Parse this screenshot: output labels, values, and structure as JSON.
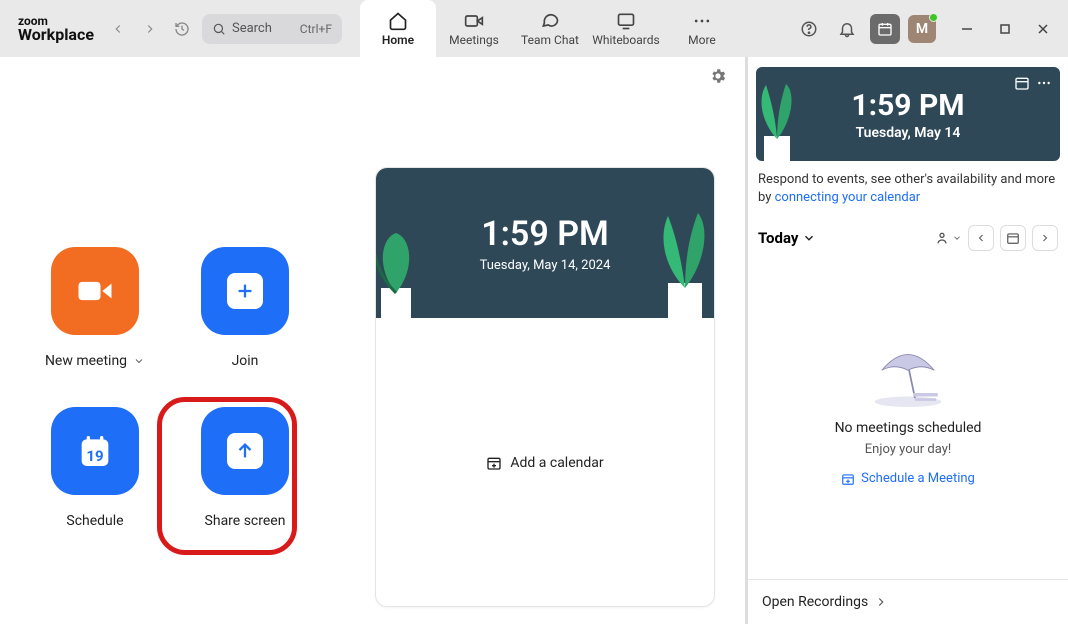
{
  "brand": {
    "line1": "zoom",
    "line2": "Workplace"
  },
  "search": {
    "placeholder": "Search",
    "shortcut": "Ctrl+F"
  },
  "tabs": {
    "home": "Home",
    "meetings": "Meetings",
    "teamchat": "Team Chat",
    "whiteboards": "Whiteboards",
    "more": "More"
  },
  "avatar": {
    "initial": "M"
  },
  "actions": {
    "new_meeting": "New meeting",
    "join": "Join",
    "schedule": "Schedule",
    "schedule_day": "19",
    "share_screen": "Share screen"
  },
  "card": {
    "time": "1:59 PM",
    "date": "Tuesday, May 14, 2024",
    "add_calendar": "Add a calendar"
  },
  "right": {
    "time": "1:59 PM",
    "date": "Tuesday, May 14",
    "msg_prefix": "Respond to events, see other's availability and more by ",
    "msg_link": "connecting your calendar",
    "today": "Today",
    "empty1": "No meetings scheduled",
    "empty2": "Enjoy your day!",
    "schedule_link": "Schedule a Meeting",
    "footer": "Open Recordings"
  }
}
